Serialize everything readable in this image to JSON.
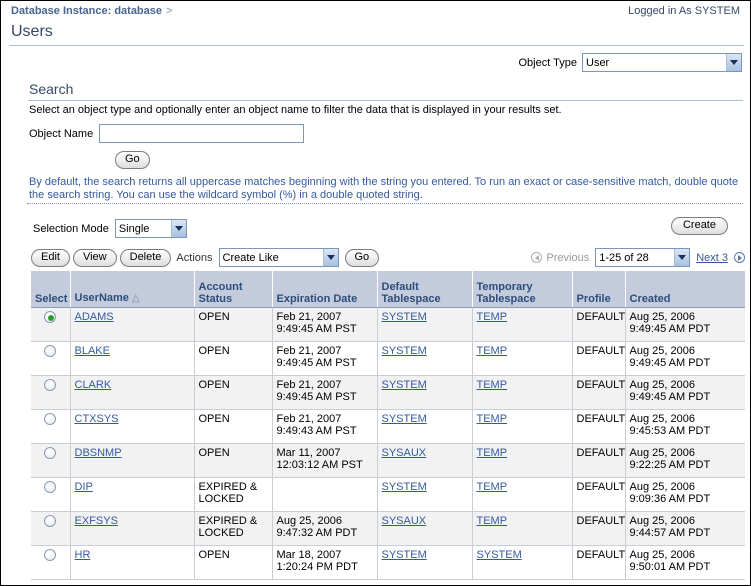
{
  "header": {
    "breadcrumb": "Database Instance: database",
    "breadcrumb_separator": ">",
    "logged_in_as": "Logged in As SYSTEM",
    "page_title": "Users"
  },
  "object_type": {
    "label": "Object Type",
    "value": "User"
  },
  "search": {
    "heading": "Search",
    "description": "Select an object type and optionally enter an object name to filter the data that is displayed in your results set.",
    "object_name_label": "Object Name",
    "object_name_value": "",
    "object_name_placeholder": "",
    "go_label": "Go",
    "note": "By default, the search returns all uppercase matches beginning with the string you entered. To run an exact or case-sensitive match, double quote the search string. You can use the wildcard symbol (%) in a double quoted string."
  },
  "selection_mode": {
    "label": "Selection Mode",
    "value": "Single"
  },
  "create_button": "Create",
  "toolbar": {
    "edit_label": "Edit",
    "view_label": "View",
    "delete_label": "Delete",
    "actions_label": "Actions",
    "action_value": "Create Like",
    "go_label": "Go",
    "previous_label": "Previous",
    "range_value": "1-25 of 28",
    "next_label": "Next 3"
  },
  "table": {
    "columns": [
      "Select",
      "UserName",
      "Account Status",
      "Expiration Date",
      "Default Tablespace",
      "Temporary Tablespace",
      "Profile",
      "Created"
    ],
    "sort_column": "UserName",
    "sort_indicator": "△",
    "rows": [
      {
        "selected": true,
        "username": "ADAMS",
        "account_status": "OPEN",
        "expiration_date_line1": "Feb 21, 2007",
        "expiration_date_line2": "9:49:45 AM PST",
        "default_tablespace": "SYSTEM",
        "temporary_tablespace": "TEMP",
        "profile": "DEFAULT",
        "created_line1": "Aug 25, 2006",
        "created_line2": "9:49:45 AM PDT"
      },
      {
        "selected": false,
        "username": "BLAKE",
        "account_status": "OPEN",
        "expiration_date_line1": "Feb 21, 2007",
        "expiration_date_line2": "9:49:45 AM PST",
        "default_tablespace": "SYSTEM",
        "temporary_tablespace": "TEMP",
        "profile": "DEFAULT",
        "created_line1": "Aug 25, 2006",
        "created_line2": "9:49:45 AM PDT"
      },
      {
        "selected": false,
        "username": "CLARK",
        "account_status": "OPEN",
        "expiration_date_line1": "Feb 21, 2007",
        "expiration_date_line2": "9:49:45 AM PST",
        "default_tablespace": "SYSTEM",
        "temporary_tablespace": "TEMP",
        "profile": "DEFAULT",
        "created_line1": "Aug 25, 2006",
        "created_line2": "9:49:45 AM PDT"
      },
      {
        "selected": false,
        "username": "CTXSYS",
        "account_status": "OPEN",
        "expiration_date_line1": "Feb 21, 2007",
        "expiration_date_line2": "9:49:43 AM PST",
        "default_tablespace": "SYSTEM",
        "temporary_tablespace": "TEMP",
        "profile": "DEFAULT",
        "created_line1": "Aug 25, 2006",
        "created_line2": "9:45:53 AM PDT"
      },
      {
        "selected": false,
        "username": "DBSNMP",
        "account_status": "OPEN",
        "expiration_date_line1": "Mar 11, 2007",
        "expiration_date_line2": "12:03:12 AM PST",
        "default_tablespace": "SYSAUX",
        "temporary_tablespace": "TEMP",
        "profile": "DEFAULT",
        "created_line1": "Aug 25, 2006",
        "created_line2": "9:22:25 AM PDT"
      },
      {
        "selected": false,
        "username": "DIP",
        "account_status": "EXPIRED & LOCKED",
        "expiration_date_line1": "",
        "expiration_date_line2": "",
        "default_tablespace": "SYSTEM",
        "temporary_tablespace": "TEMP",
        "profile": "DEFAULT",
        "created_line1": "Aug 25, 2006",
        "created_line2": "9:09:36 AM PDT"
      },
      {
        "selected": false,
        "username": "EXFSYS",
        "account_status": "EXPIRED & LOCKED",
        "expiration_date_line1": "Aug 25, 2006",
        "expiration_date_line2": "9:47:32 AM PDT",
        "default_tablespace": "SYSAUX",
        "temporary_tablespace": "TEMP",
        "profile": "DEFAULT",
        "created_line1": "Aug 25, 2006",
        "created_line2": "9:44:57 AM PDT"
      },
      {
        "selected": false,
        "username": "HR",
        "account_status": "OPEN",
        "expiration_date_line1": "Mar 18, 2007",
        "expiration_date_line2": "1:20:24 PM PDT",
        "default_tablespace": "SYSTEM",
        "temporary_tablespace": "SYSTEM",
        "profile": "DEFAULT",
        "created_line1": "Aug 25, 2006",
        "created_line2": "9:50:01 AM PDT"
      }
    ]
  },
  "colors": {
    "header_blue": "#36486a",
    "link_blue": "#36599e",
    "table_header_bg": "#c3cbdc",
    "row_alt_bg": "#f2f2f2",
    "radio_selected": "#2a9d2a"
  }
}
